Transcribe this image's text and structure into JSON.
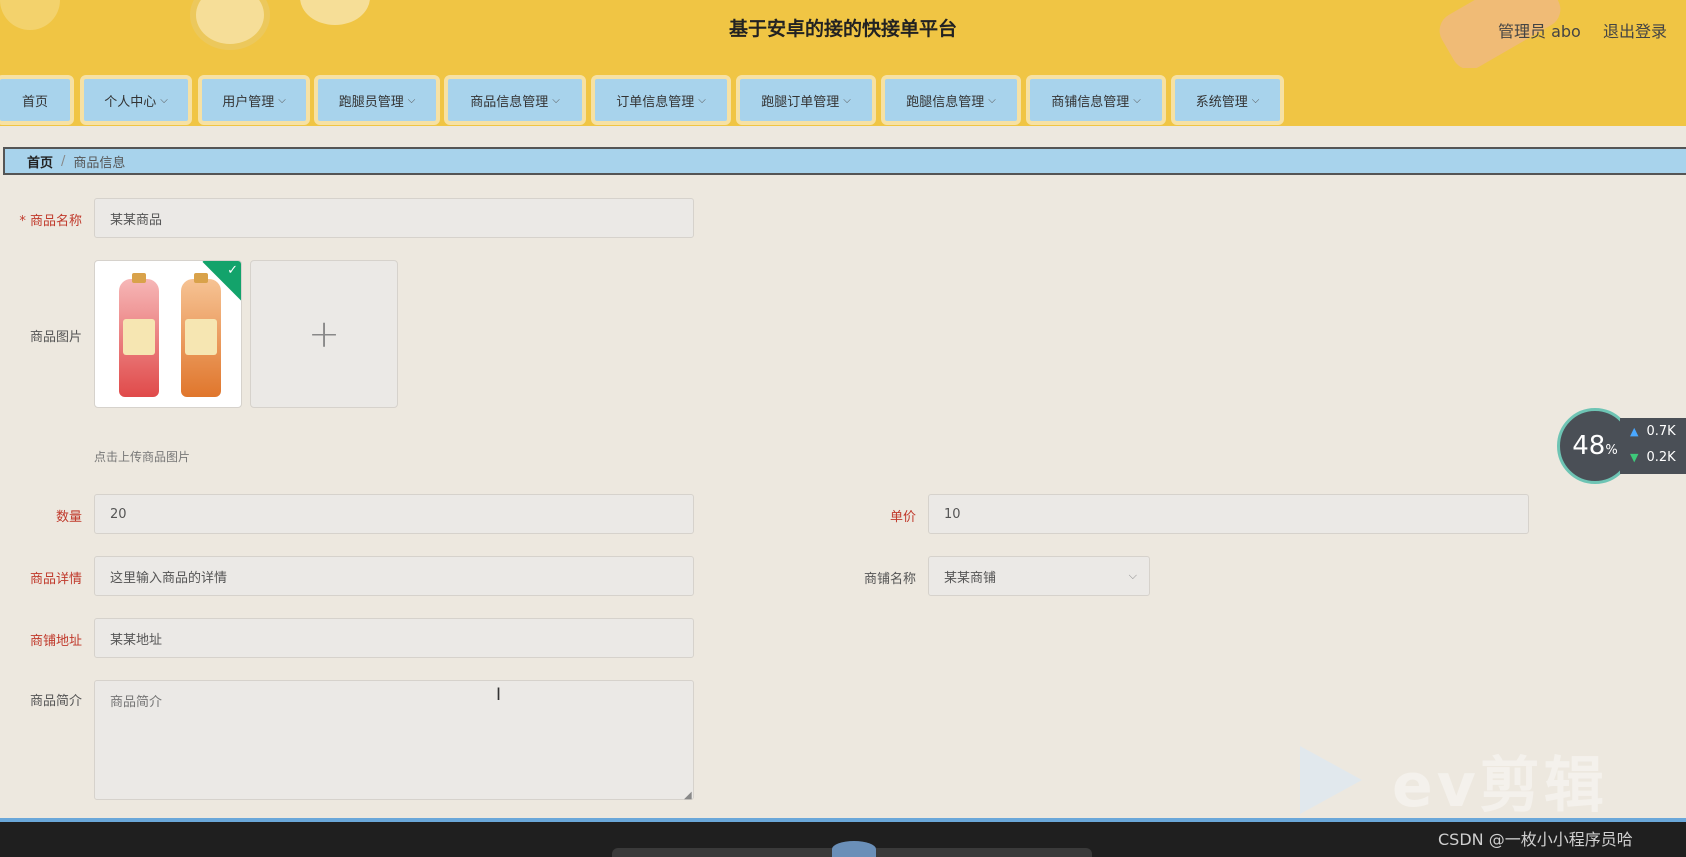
{
  "header": {
    "title": "基于安卓的接的快接单平台",
    "admin_label": "管理员 abo",
    "logout_label": "退出登录"
  },
  "nav": {
    "items": [
      {
        "label": "首页"
      },
      {
        "label": "个人中心"
      },
      {
        "label": "用户管理"
      },
      {
        "label": "跑腿员管理"
      },
      {
        "label": "商品信息管理"
      },
      {
        "label": "订单信息管理"
      },
      {
        "label": "跑腿订单管理"
      },
      {
        "label": "跑腿信息管理"
      },
      {
        "label": "商铺信息管理"
      },
      {
        "label": "系统管理"
      }
    ]
  },
  "breadcrumb": {
    "home": "首页",
    "separator": "/",
    "current": "商品信息"
  },
  "form": {
    "name_label": "商品名称",
    "name_value": "某某商品",
    "image_label": "商品图片",
    "upload_hint": "点击上传商品图片",
    "quantity_label": "数量",
    "quantity_value": "20",
    "price_label": "单价",
    "price_value": "10",
    "details_label": "商品详情",
    "details_value": "这里输入商品的详情",
    "shop_label": "商铺名称",
    "shop_value": "某某商铺",
    "address_label": "商铺地址",
    "address_value": "某某地址",
    "intro_label": "商品简介",
    "intro_placeholder": "商品简介"
  },
  "widget": {
    "percent": "48",
    "percent_sign": "%",
    "upload_speed": "0.7K",
    "download_speed": "0.2K"
  },
  "watermark": {
    "ev_text": "ev剪辑",
    "csdn_text": "CSDN @一枚小小程序员哈"
  },
  "colors": {
    "header_bg": "#f0c544",
    "nav_item_bg": "#a8d3ec",
    "page_bg": "#ede8df",
    "required_label": "#c0392b",
    "upload_success": "#13a36b"
  }
}
